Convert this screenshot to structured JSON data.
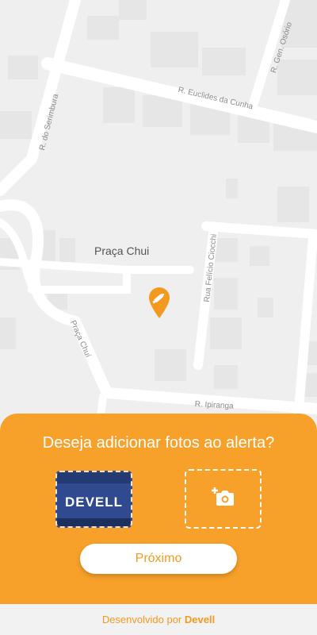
{
  "map": {
    "place_name": "Praça Chui",
    "streets": {
      "euclides": "R. Euclides da Cunha",
      "osorio": "R. Gen. Osório",
      "serimbura": "R. do Serimbura",
      "felicio": "Rua Felício Ciocchi",
      "praca_chui": "Praça Chuí",
      "ipiranga": "R. Ipiranga"
    },
    "marker_icon": "alert-pin-icon"
  },
  "sheet": {
    "title": "Deseja adicionar fotos ao alerta?",
    "photo_logo": "DEVELL",
    "add_photo_icon": "add-camera-icon",
    "next_label": "Próximo",
    "accent_color": "#f7a02a"
  },
  "footer": {
    "prefix": "Desenvolvido por",
    "brand": "Devell"
  }
}
